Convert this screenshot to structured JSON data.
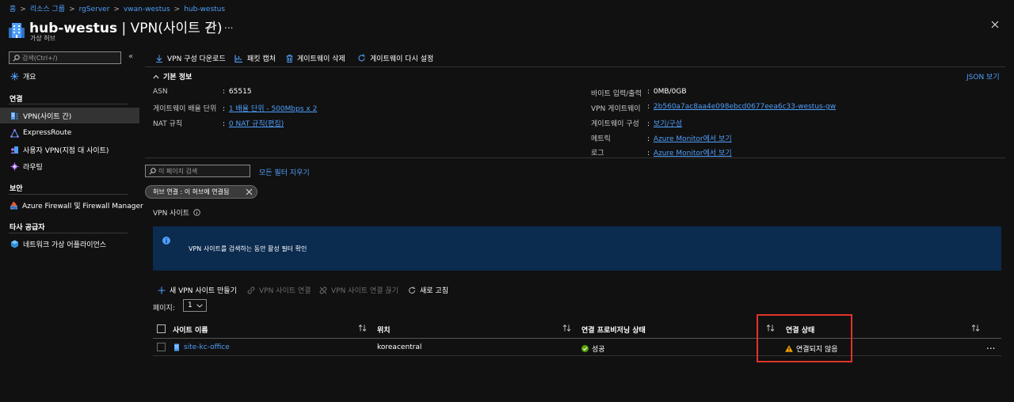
{
  "breadcrumb": [
    "홈",
    "리소스 그룹",
    "rgServer",
    "vwan-westus",
    "hub-westus"
  ],
  "header": {
    "title_bold": "hub-westus",
    "title_rest": " | VPN(사이트 간)",
    "subtitle": "가상 허브",
    "more": "..."
  },
  "sidebar": {
    "search_placeholder": "검색(Ctrl+/)",
    "collapse": "«",
    "overview": "개요",
    "sections": {
      "connectivity": "연결",
      "security": "보안",
      "third_party": "타사 공급자"
    },
    "items": {
      "vpn_s2s": "VPN(사이트 간)",
      "expressroute": "ExpressRoute",
      "user_vpn": "사용자 VPN(지점 대 사이트)",
      "routing": "라우팅",
      "firewall": "Azure Firewall 및 Firewall Manager",
      "nva": "네트워크 가상 어플라이언스"
    }
  },
  "toolbar": {
    "download": "VPN 구성 다운로드",
    "capture": "패킷 캡처",
    "delete": "게이트웨이 삭제",
    "reset": "게이트웨이 다시 설정"
  },
  "essentials": {
    "title": "기본 정보",
    "json_view": "JSON 보기",
    "left": {
      "asn_label": "ASN",
      "asn_value": "65515",
      "scale_label": "게이트웨이 배율 단위",
      "scale_value": "1 배율 단위 - 500Mbps x 2",
      "nat_label": "NAT 규칙",
      "nat_value": "0 NAT 규칙(편집)"
    },
    "right": {
      "bytes_label": "바이트 입력/출력",
      "bytes_value": "0MB/0GB",
      "gw_label": "VPN 게이트웨이",
      "gw_value": "2b560a7ac8aa4e098ebcd0677eea6c33-westus-gw",
      "gwcfg_label": "게이트웨이 구성",
      "gwcfg_value": "보기/구성",
      "metrics_label": "메트릭",
      "metrics_value": "Azure Monitor에서 보기",
      "logs_label": "로그",
      "logs_value": "Azure Monitor에서 보기"
    }
  },
  "filter": {
    "placeholder": "이 페이지 검색",
    "clear_all": "모든 필터 지우기",
    "pill": "허브 연결 : 이 허브에 연결됨"
  },
  "vpn_sites_label": "VPN 사이트",
  "info_banner": "VPN 사이트를 검색하는 동안 활성 필터 확인",
  "grid_toolbar": {
    "create": "새 VPN 사이트 만들기",
    "connect": "VPN 사이트 연결",
    "disconnect": "VPN 사이트 연결 끊기",
    "refresh": "새로 고침"
  },
  "paging": {
    "label": "페이지:",
    "value": "1"
  },
  "table": {
    "columns": [
      "사이트 이름",
      "위치",
      "연결 프로비저닝 상태",
      "연결 상태"
    ],
    "rows": [
      {
        "name": "site-kc-office",
        "location": "koreacentral",
        "provisioning": "성공",
        "status": "연결되지 않음"
      }
    ]
  },
  "colors": {
    "background": "#111111",
    "link": "#4f9efb",
    "banner": "#0b2b4f",
    "highlight": "#e0332b",
    "success": "#57a300",
    "warning": "#f4a100"
  }
}
